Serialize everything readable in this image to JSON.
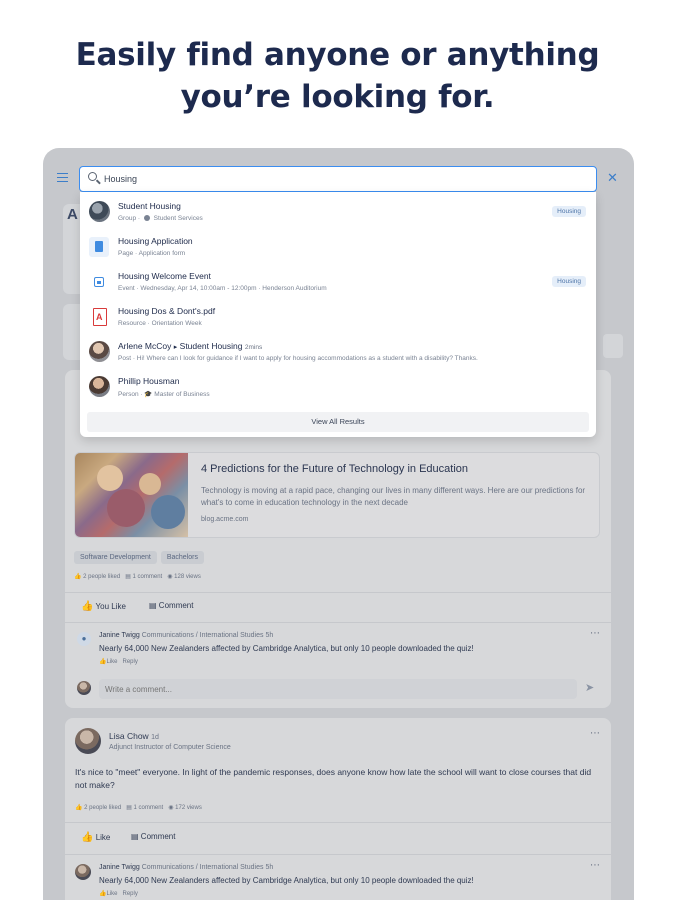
{
  "headline": {
    "line1": "Easily find anyone or anything",
    "line2": "you’re looking for."
  },
  "search": {
    "value": "Housing"
  },
  "results": [
    {
      "title": "Student Housing",
      "type": "Group",
      "meta": "Student Services",
      "badge": "Housing"
    },
    {
      "title": "Housing Application",
      "type": "Page",
      "meta": "Application form",
      "badge": ""
    },
    {
      "title": "Housing Welcome Event",
      "type": "Event",
      "meta": "Wednesday, Apr 14, 10:00am - 12:00pm",
      "meta2": "Henderson Auditorium",
      "badge": "Housing"
    },
    {
      "title": "Housing Dos & Dont's.pdf",
      "type": "Resource",
      "meta": "Orientation Week",
      "badge": ""
    },
    {
      "title_a": "Arlene McCoy",
      "title_sep": "▸",
      "title_b": "Student Housing",
      "time": "2mins",
      "type": "Post",
      "meta": "Hi! Where can I look for guidance if I want to apply for housing accommodations as a student with a disability? Thanks.",
      "badge": ""
    },
    {
      "title": "Phillip Housman",
      "type": "Person",
      "meta": "Master of Business",
      "badge": ""
    }
  ],
  "view_all": "View All Results",
  "feed": {
    "post1": {
      "link_title": "4 Predictions for the Future of Technology in Education",
      "link_desc": "Technology is moving at a rapid pace, changing our lives in many different ways. Here are our predictions for what's to come in education technology in the next decade",
      "link_domain": "blog.acme.com",
      "tags": [
        "Software Development",
        "Bachelors"
      ],
      "stats": {
        "likes": "2 people liked",
        "comments": "1 comment",
        "views": "128 views"
      },
      "like_label": "You Like",
      "comment_label": "Comment",
      "comment": {
        "author": "Janine Twigg",
        "role": "Communications / International Studies",
        "time": "5h",
        "text": "Nearly 64,000 New Zealanders affected by Cambridge Analytica, but only 10 people downloaded the quiz!",
        "like": "Like",
        "reply": "Reply"
      },
      "write_placeholder": "Write a comment..."
    },
    "post2": {
      "author": "Lisa Chow",
      "time": "1d",
      "role": "Adjunct Instructor of Computer Science",
      "text": "It's nice to \"meet\" everyone. In light of the pandemic responses, does anyone know how late the school will want to close courses that did not make?",
      "stats": {
        "likes": "2 people liked",
        "comments": "1 comment",
        "views": "172 views"
      },
      "like_label": "Like",
      "comment_label": "Comment",
      "comment": {
        "author": "Janine Twigg",
        "role": "Communications / International Studies",
        "time": "5h",
        "text": "Nearly 64,000 New Zealanders affected by Cambridge Analytica, but only 10 people downloaded the quiz!",
        "like": "Like",
        "reply": "Reply"
      }
    }
  },
  "colors": {
    "accent": "#3b8df0",
    "headline": "#1d2a4e",
    "device_bg": "#c6c8cc"
  }
}
